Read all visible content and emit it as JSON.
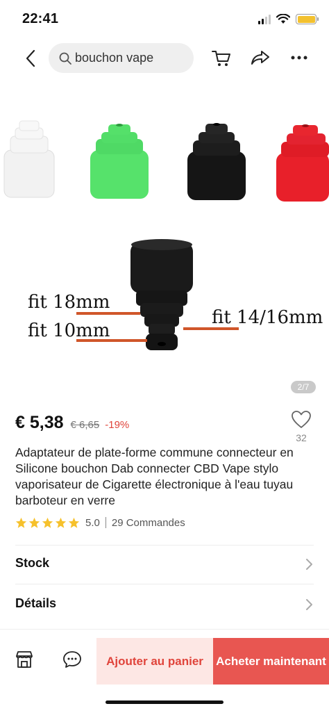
{
  "status_bar": {
    "time": "22:41"
  },
  "nav": {
    "search_query": "bouchon vape"
  },
  "image": {
    "label_left_top": "fit 18mm",
    "label_left_bottom": "fit 10mm",
    "label_right": "fit 14/16mm",
    "counter": "2/7",
    "colors": {
      "white": "#f2f2f2",
      "green": "#56e26b",
      "black": "#151515",
      "red": "#e8202a",
      "line": "#d0562a"
    }
  },
  "product": {
    "price": "€ 5,38",
    "original_price": "€ 6,65",
    "discount": "-19%",
    "wishlist_count": "32",
    "title": "Adaptateur de plate-forme commune connecteur en Silicone bouchon Dab connecter CBD Vape stylo vaporisateur de Cigarette électronique à l'eau tuyau barboteur en verre",
    "rating": "5.0",
    "stars": 5,
    "orders": "29 Commandes"
  },
  "rows": {
    "stock": "Stock",
    "details": "Détails"
  },
  "bottom": {
    "add_to_cart": "Ajouter au panier",
    "buy_now": "Acheter maintenant",
    "icons": [
      "store-icon",
      "chat-icon"
    ]
  },
  "accent": "#e85651"
}
